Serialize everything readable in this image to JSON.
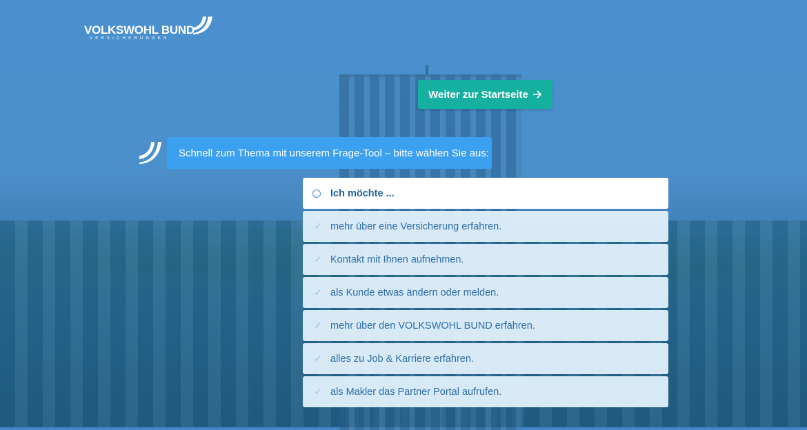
{
  "logo": {
    "name": "VOLKSWOHL BUND",
    "subtitle": "VERSICHERUNGEN"
  },
  "cta": {
    "label": "Weiter zur Startseite",
    "icon": "arrow-right-icon"
  },
  "prompt": {
    "text": "Schnell zum Thema mit unserem Frage-Tool – bitte wählen Sie aus:"
  },
  "question": {
    "label": "Ich möchte ..."
  },
  "options": [
    "mehr über eine Versicherung erfahren.",
    "Kontakt mit Ihnen aufnehmen.",
    "als Kunde etwas ändern oder melden.",
    "mehr über den VOLKSWOHL BUND erfahren.",
    "alles zu Job & Karriere erfahren.",
    "als Makler das Partner Portal aufrufen."
  ],
  "colors": {
    "accent": "#15b0a0",
    "bubble": "#3ba0ef",
    "text": "#2f6ea4"
  }
}
